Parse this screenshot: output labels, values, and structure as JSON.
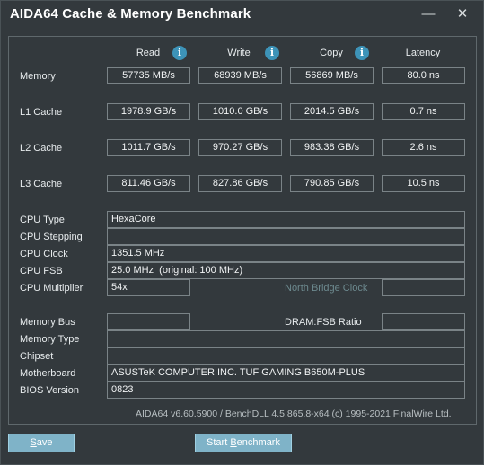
{
  "window": {
    "title": "AIDA64 Cache & Memory Benchmark",
    "minimize_glyph": "—",
    "close_glyph": "✕"
  },
  "columns": {
    "read": "Read",
    "write": "Write",
    "copy": "Copy",
    "latency": "Latency",
    "info_glyph": "i"
  },
  "bench_rows": [
    {
      "label": "Memory",
      "read": "57735 MB/s",
      "write": "68939 MB/s",
      "copy": "56869 MB/s",
      "latency": "80.0 ns"
    },
    {
      "label": "L1 Cache",
      "read": "1978.9 GB/s",
      "write": "1010.0 GB/s",
      "copy": "2014.5 GB/s",
      "latency": "0.7 ns"
    },
    {
      "label": "L2 Cache",
      "read": "1011.7 GB/s",
      "write": "970.27 GB/s",
      "copy": "983.38 GB/s",
      "latency": "2.6 ns"
    },
    {
      "label": "L3 Cache",
      "read": "811.46 GB/s",
      "write": "827.86 GB/s",
      "copy": "790.85 GB/s",
      "latency": "10.5 ns"
    }
  ],
  "cpu": {
    "type_label": "CPU Type",
    "type_value": "HexaCore",
    "stepping_label": "CPU Stepping",
    "stepping_value": "",
    "clock_label": "CPU Clock",
    "clock_value": "1351.5 MHz",
    "fsb_label": "CPU FSB",
    "fsb_value": "25.0 MHz  (original: 100 MHz)",
    "multiplier_label": "CPU Multiplier",
    "multiplier_value": "54x",
    "north_bridge_clock_label": "North Bridge Clock",
    "north_bridge_clock_value": ""
  },
  "system": {
    "memory_bus_label": "Memory Bus",
    "memory_bus_value": "",
    "dram_fsb_label": "DRAM:FSB Ratio",
    "dram_fsb_value": "",
    "memory_type_label": "Memory Type",
    "memory_type_value": "",
    "chipset_label": "Chipset",
    "chipset_value": "",
    "motherboard_label": "Motherboard",
    "motherboard_value": "ASUSTeK COMPUTER INC. TUF GAMING B650M-PLUS",
    "bios_label": "BIOS Version",
    "bios_value": "0823"
  },
  "footer": {
    "version_text": "AIDA64 v6.60.5900 / BenchDLL 4.5.865.8-x64  (c) 1995-2021 FinalWire Ltd."
  },
  "buttons": {
    "save_first": "S",
    "save_rest": "ave",
    "start_prefix": "Start ",
    "start_accel": "B",
    "start_rest": "enchmark"
  }
}
